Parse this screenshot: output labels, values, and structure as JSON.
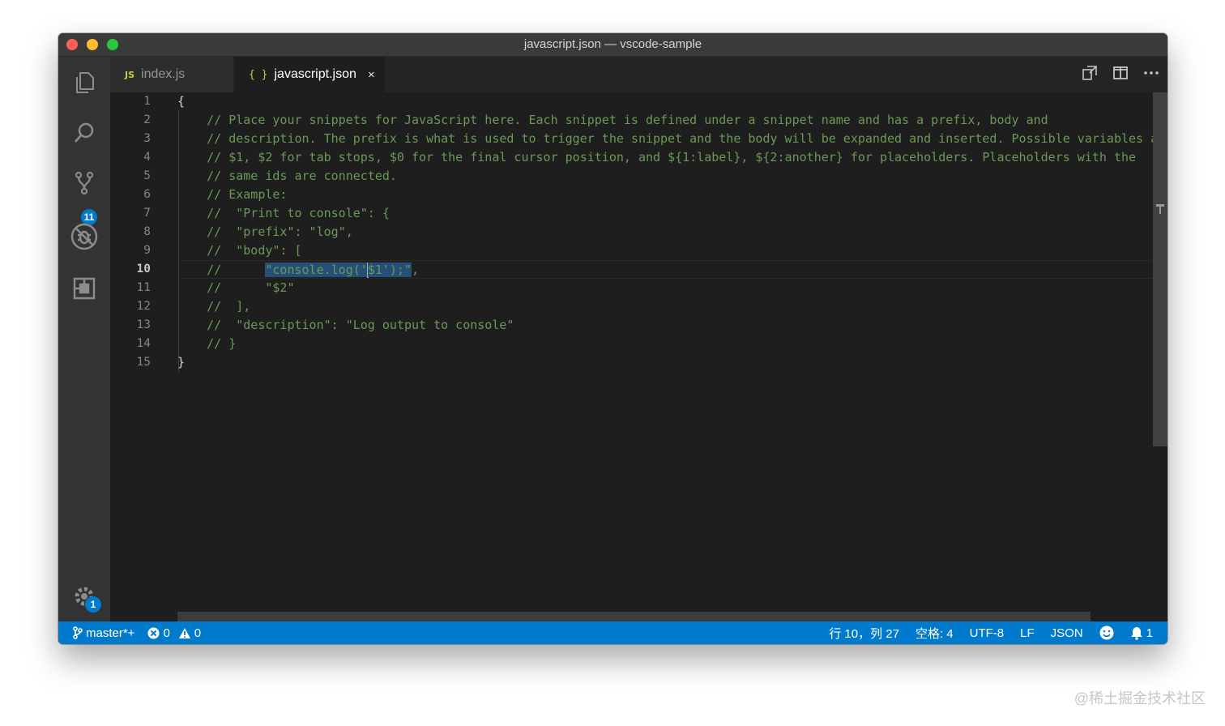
{
  "window": {
    "title": "javascript.json — vscode-sample"
  },
  "activity_bar": {
    "items": [
      "explorer-icon",
      "search-icon",
      "source-control-icon",
      "debug-icon",
      "extensions-icon"
    ],
    "scm_badge": "11",
    "settings_badge": "1"
  },
  "tabs": [
    {
      "icon": "JS",
      "label": "index.js",
      "active": false
    },
    {
      "icon": "{ }",
      "label": "javascript.json",
      "active": true,
      "close": "×"
    }
  ],
  "editor": {
    "line_numbers": [
      "1",
      "2",
      "3",
      "4",
      "5",
      "6",
      "7",
      "8",
      "9",
      "10",
      "11",
      "12",
      "13",
      "14",
      "15"
    ],
    "active_line": "10",
    "lines": [
      "{",
      "    // Place your snippets for JavaScript here. Each snippet is defined under a snippet name and has a prefix, body and",
      "    // description. The prefix is what is used to trigger the snippet and the body will be expanded and inserted. Possible variables are:",
      "    // $1, $2 for tab stops, $0 for the final cursor position, and ${1:label}, ${2:another} for placeholders. Placeholders with the",
      "    // same ids are connected.",
      "    // Example:",
      "    //  \"Print to console\": {",
      "    //  \"prefix\": \"log\",",
      "    //  \"body\": [",
      "",
      "    //      \"$2\"",
      "    //  ],",
      "    //  \"description\": \"Log output to console\"",
      "    // }",
      "}"
    ],
    "line10": {
      "prefix": "    //      ",
      "selected_before_cursor": "\"console.log('",
      "selected_after_cursor": "$1');\"",
      "suffix": ","
    }
  },
  "status_bar": {
    "branch": "master*+",
    "errors": "0",
    "warnings": "0",
    "position": "行 10，列 27",
    "indent": "空格: 4",
    "encoding": "UTF-8",
    "eol": "LF",
    "language": "JSON",
    "notifications": "1"
  },
  "watermark": "@稀土掘金技术社区",
  "colors": {
    "status_bar": "#007acc",
    "comment": "#6a9955",
    "selection": "#264f78",
    "editor_bg": "#1e1e1e"
  }
}
